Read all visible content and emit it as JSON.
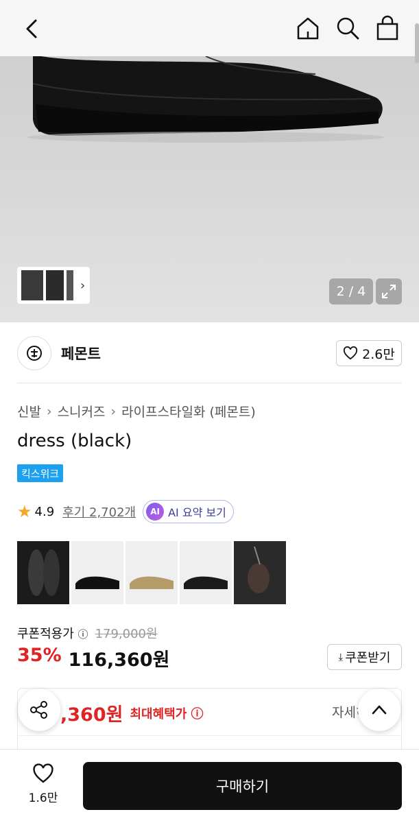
{
  "nav": {
    "back_icon": "chevron-left-icon",
    "icons": [
      "home-icon",
      "search-icon",
      "shopping-bag-icon"
    ]
  },
  "gallery": {
    "counter": "2 / 4",
    "expand_icon": "expand-icon"
  },
  "brand": {
    "name": "페몬트",
    "likes": "2.6만"
  },
  "breadcrumb": [
    "신발",
    "스니커즈",
    "라이프스타일화 (페몬트)"
  ],
  "product": {
    "title": "dress (black)",
    "tag": "킥스위크",
    "rating": "4.9",
    "reviews": "후기 2,702개",
    "ai_badge": "AI",
    "ai_label": "AI 요약 보기"
  },
  "price": {
    "coupon_label": "쿠폰적용가",
    "original": "179,000원",
    "discount": "35%",
    "final": "116,360원",
    "coupon_button": "쿠폰받기"
  },
  "benefit": {
    "max_price": ",360원",
    "label": "최대혜택가",
    "detail": "자세히"
  },
  "bottom": {
    "like_count": "1.6만",
    "buy_label": "구매하기"
  },
  "colors": {
    "discount": "#e02424",
    "tag_bg": "#1ea0f0",
    "buy_bg": "#111111"
  }
}
